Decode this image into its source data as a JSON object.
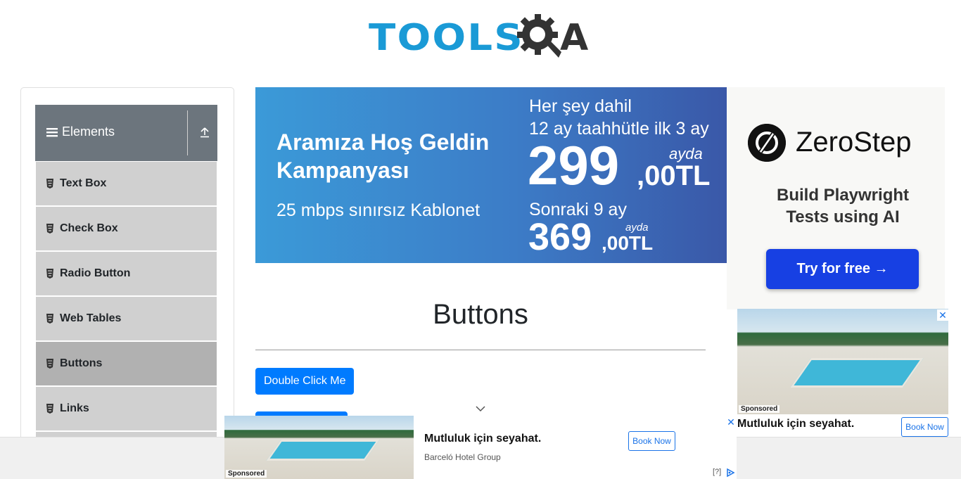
{
  "header": {
    "logo_text_left": "TOOLS",
    "logo_text_right": "A"
  },
  "sidebar": {
    "group_title": "Elements",
    "items": [
      {
        "label": "Text Box",
        "active": false
      },
      {
        "label": "Check Box",
        "active": false
      },
      {
        "label": "Radio Button",
        "active": false
      },
      {
        "label": "Web Tables",
        "active": false
      },
      {
        "label": "Buttons",
        "active": true
      },
      {
        "label": "Links",
        "active": false
      }
    ]
  },
  "banner_ad": {
    "headline": "Aramıza Hoş Geldin Kampanyası",
    "subline": "25 mbps sınırsız Kablonet",
    "line1": "Her şey dahil",
    "line2": "12 ay taahhütle ilk 3 ay",
    "price1": "299",
    "price1_dec": ",00TL",
    "per1": "ayda",
    "line3": "Sonraki 9 ay",
    "price2": "369",
    "price2_dec": ",00TL",
    "per2": "ayda"
  },
  "main": {
    "title": "Buttons",
    "double_click_label": "Double Click Me"
  },
  "right_ad": {
    "brand": "ZeroStep",
    "tagline": "Build Playwright Tests using AI",
    "cta": "Try for free →",
    "hotel_caption": "Mutluluk için seyahat.",
    "hotel_book": "Book Now",
    "sponsored": "Sponsored",
    "close": "✕"
  },
  "bottom_ad": {
    "title": "Mutluluk için seyahat.",
    "source": "Barceló Hotel Group",
    "book": "Book Now",
    "sponsored": "Sponsored",
    "close": "✕",
    "info": "[?]"
  },
  "colors": {
    "primary": "#007bff",
    "logo_blue": "#1a9ad6",
    "menu_bg": "#d0d0d0",
    "menu_active": "#b1b1b1",
    "group_header": "#6c757d"
  }
}
